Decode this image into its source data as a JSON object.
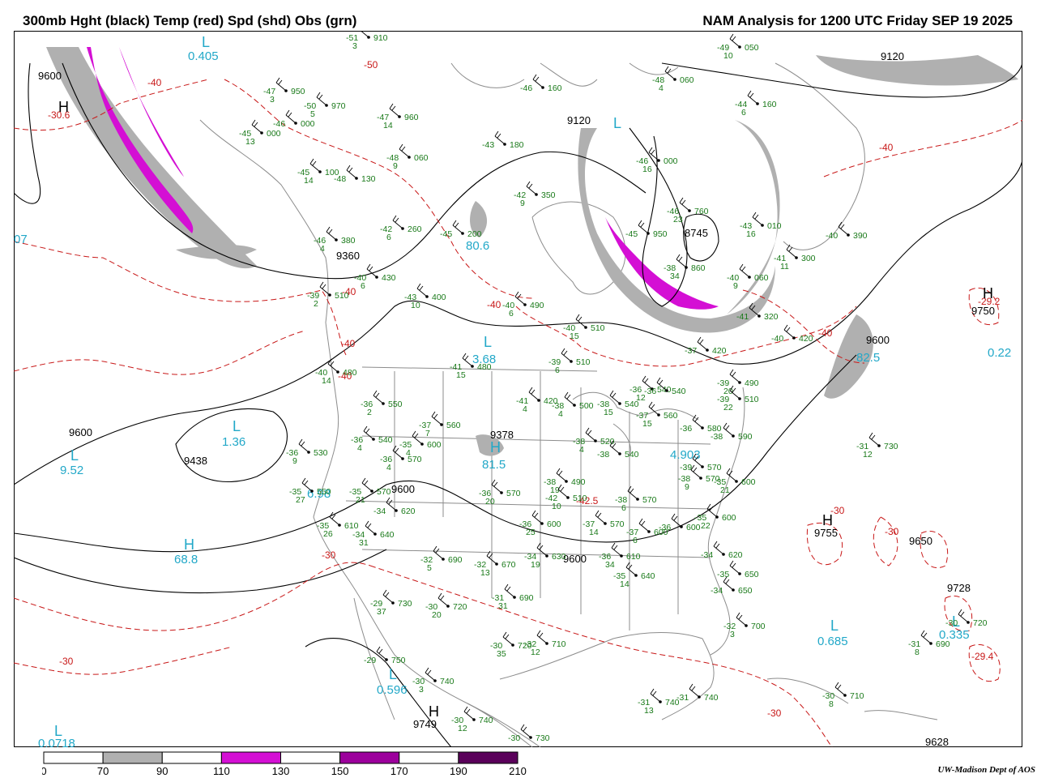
{
  "title_left": "300mb Hght (black) Temp (red) Spd (shd) Obs (grn)",
  "title_right": "NAM Analysis for 1200 UTC Friday  SEP 19 2025",
  "credit": "UW-Madison  Dept of AOS",
  "legend": {
    "ticks": [
      "0",
      "70",
      "90",
      "110",
      "130",
      "150",
      "170",
      "190",
      "210"
    ],
    "colors": [
      "#ffffff",
      "#b0b0b0",
      "#ffffff",
      "#d40fd4",
      "#ffffff",
      "#9c009c",
      "#ffffff",
      "#5a005a"
    ]
  },
  "colors": {
    "height": "#000000",
    "temp": "#c81818",
    "speed_label": "#22a8c8",
    "obs": "#1a7a1a",
    "map": "#8c8c8c"
  },
  "height_labels": [
    "9600",
    "9120",
    "9120",
    "8745",
    "9360",
    "9600",
    "9438",
    "9378",
    "9600",
    "9600",
    "9600",
    "9750",
    "9728",
    "9749",
    "9628",
    "9650",
    "9755"
  ],
  "temp_labels": [
    "-30.6",
    "-40",
    "-50",
    "-40",
    "-40",
    "-40",
    "-40",
    "-40",
    "-40",
    "-42.5",
    "-30",
    "-30",
    "-30",
    "-30",
    "-30",
    "-29.4",
    "-29.2"
  ],
  "spd_labels": [
    "0.405",
    "3.68",
    "1.36",
    "9.52",
    "68.8",
    "0.596",
    "0.0718",
    "81.5",
    "0.685",
    "0.335",
    "0.22",
    "07",
    "80.6",
    "82.5",
    "6.98",
    "4.903"
  ],
  "hl_letters": [
    "L",
    "H",
    "L",
    "L",
    "H",
    "L",
    "L",
    "H",
    "L",
    "L",
    "H",
    "L",
    "H",
    "H",
    "L"
  ],
  "obs": [
    {
      "t": "-51",
      "z": "910",
      "s": "3"
    },
    {
      "t": "-47",
      "z": "950",
      "s": "3"
    },
    {
      "t": "-50",
      "z": "970",
      "s": "5"
    },
    {
      "t": "-46",
      "z": "000",
      "s": ""
    },
    {
      "t": "-45",
      "z": "000",
      "s": "13"
    },
    {
      "t": "-47",
      "z": "960",
      "s": "14"
    },
    {
      "t": "-45",
      "z": "100",
      "s": "14"
    },
    {
      "t": "-48",
      "z": "130",
      "s": ""
    },
    {
      "t": "-48",
      "z": "060",
      "s": "9"
    },
    {
      "t": "-43",
      "z": "180",
      "s": ""
    },
    {
      "t": "-46",
      "z": "160",
      "s": ""
    },
    {
      "t": "-48",
      "z": "060",
      "s": "4"
    },
    {
      "t": "-49",
      "z": "050",
      "s": "10"
    },
    {
      "t": "-44",
      "z": "160",
      "s": "6"
    },
    {
      "t": "-46",
      "z": "000",
      "s": "16"
    },
    {
      "t": "-46",
      "z": "760",
      "s": "23"
    },
    {
      "t": "-45",
      "z": "950",
      "s": ""
    },
    {
      "t": "-43",
      "z": "010",
      "s": "16"
    },
    {
      "t": "-40",
      "z": "390",
      "s": ""
    },
    {
      "t": "-41",
      "z": "300",
      "s": "11"
    },
    {
      "t": "-38",
      "z": "860",
      "s": "34"
    },
    {
      "t": "-40",
      "z": "060",
      "s": "9"
    },
    {
      "t": "-41",
      "z": "320",
      "s": ""
    },
    {
      "t": "-40",
      "z": "420",
      "s": ""
    },
    {
      "t": "-42",
      "z": "350",
      "s": "9"
    },
    {
      "t": "-42",
      "z": "260",
      "s": "6"
    },
    {
      "t": "-45",
      "z": "200",
      "s": ""
    },
    {
      "t": "-46",
      "z": "380",
      "s": "4"
    },
    {
      "t": "-40",
      "z": "430",
      "s": "6"
    },
    {
      "t": "-43",
      "z": "400",
      "s": "10"
    },
    {
      "t": "-39",
      "z": "510",
      "s": "2"
    },
    {
      "t": "-40",
      "z": "490",
      "s": "6"
    },
    {
      "t": "-40",
      "z": "510",
      "s": "15"
    },
    {
      "t": "-37",
      "z": "420",
      "s": ""
    },
    {
      "t": "-41",
      "z": "480",
      "s": "15"
    },
    {
      "t": "-39",
      "z": "510",
      "s": "6"
    },
    {
      "t": "-40",
      "z": "480",
      "s": "14"
    },
    {
      "t": "-36",
      "z": "550",
      "s": "2"
    },
    {
      "t": "-41",
      "z": "420",
      "s": "4"
    },
    {
      "t": "-38",
      "z": "500",
      "s": "4"
    },
    {
      "t": "-38",
      "z": "540",
      "s": "15"
    },
    {
      "t": "-36",
      "z": "540",
      "s": "12"
    },
    {
      "t": "-36",
      "z": "540",
      "s": ""
    },
    {
      "t": "-39",
      "z": "490",
      "s": "20"
    },
    {
      "t": "-39",
      "z": "510",
      "s": "22"
    },
    {
      "t": "-37",
      "z": "560",
      "s": "7"
    },
    {
      "t": "-36",
      "z": "540",
      "s": "4"
    },
    {
      "t": "-36",
      "z": "570",
      "s": "4"
    },
    {
      "t": "-35",
      "z": "600",
      "s": "4"
    },
    {
      "t": "-37",
      "z": "560",
      "s": "15"
    },
    {
      "t": "-36",
      "z": "580",
      "s": ""
    },
    {
      "t": "-38",
      "z": "520",
      "s": "4"
    },
    {
      "t": "-38",
      "z": "540",
      "s": ""
    },
    {
      "t": "-38",
      "z": "590",
      "s": ""
    },
    {
      "t": "-36",
      "z": "530",
      "s": "9"
    },
    {
      "t": "-39",
      "z": "570",
      "s": ""
    },
    {
      "t": "-35",
      "z": "550",
      "s": "27"
    },
    {
      "t": "-35",
      "z": "570",
      "s": "21"
    },
    {
      "t": "-38",
      "z": "490",
      "s": "19"
    },
    {
      "t": "-38",
      "z": "570",
      "s": "9"
    },
    {
      "t": "-35",
      "z": "600",
      "s": "21"
    },
    {
      "t": "-34",
      "z": "620",
      "s": ""
    },
    {
      "t": "-36",
      "z": "570",
      "s": "20"
    },
    {
      "t": "-35",
      "z": "610",
      "s": "26"
    },
    {
      "t": "-34",
      "z": "640",
      "s": "31"
    },
    {
      "t": "-42",
      "z": "510",
      "s": "10"
    },
    {
      "t": "-38",
      "z": "570",
      "s": "6"
    },
    {
      "t": "-35",
      "z": "600",
      "s": "22"
    },
    {
      "t": "-36",
      "z": "600",
      "s": "25"
    },
    {
      "t": "-37",
      "z": "570",
      "s": "14"
    },
    {
      "t": "-37",
      "z": "600",
      "s": "6"
    },
    {
      "t": "-36",
      "z": "600",
      "s": ""
    },
    {
      "t": "-34",
      "z": "620",
      "s": ""
    },
    {
      "t": "-32",
      "z": "690",
      "s": "5"
    },
    {
      "t": "-32",
      "z": "670",
      "s": "13"
    },
    {
      "t": "-34",
      "z": "630",
      "s": "19"
    },
    {
      "t": "-36",
      "z": "610",
      "s": "34"
    },
    {
      "t": "-35",
      "z": "640",
      "s": "14"
    },
    {
      "t": "-35",
      "z": "650",
      "s": ""
    },
    {
      "t": "-34",
      "z": "650",
      "s": ""
    },
    {
      "t": "-29",
      "z": "730",
      "s": "37"
    },
    {
      "t": "-30",
      "z": "720",
      "s": "20"
    },
    {
      "t": "-31",
      "z": "690",
      "s": "31"
    },
    {
      "t": "-32",
      "z": "700",
      "s": "3"
    },
    {
      "t": "-29",
      "z": "750",
      "s": ""
    },
    {
      "t": "-30",
      "z": "740",
      "s": "3"
    },
    {
      "t": "-30",
      "z": "720",
      "s": "35"
    },
    {
      "t": "-32",
      "z": "710",
      "s": "12"
    },
    {
      "t": "-31",
      "z": "740",
      "s": "13"
    },
    {
      "t": "-31",
      "z": "740",
      "s": ""
    },
    {
      "t": "-30",
      "z": "710",
      "s": "8"
    },
    {
      "t": "-30",
      "z": "740",
      "s": "12"
    },
    {
      "t": "-30",
      "z": "730",
      "s": ""
    },
    {
      "t": "-31",
      "z": "730",
      "s": "12"
    },
    {
      "t": "-31",
      "z": "690",
      "s": "8"
    },
    {
      "t": "-30",
      "z": "720",
      "s": ""
    }
  ]
}
